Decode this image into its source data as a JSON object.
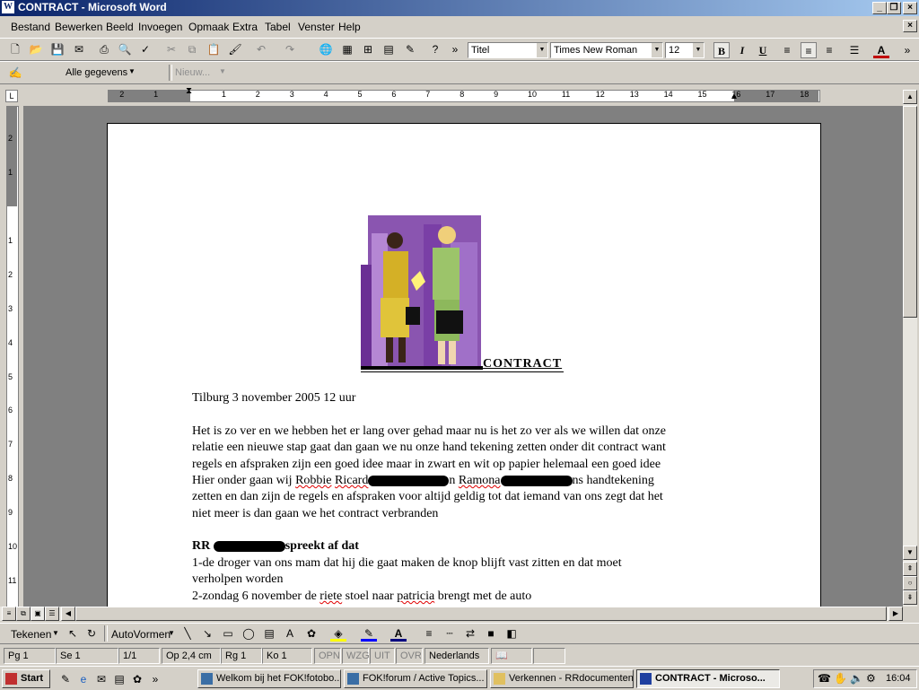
{
  "window": {
    "title": "CONTRACT - Microsoft Word"
  },
  "menu": [
    "Bestand",
    "Bewerken",
    "Beeld",
    "Invoegen",
    "Opmaak",
    "Extra",
    "Tabel",
    "Venster",
    "Help"
  ],
  "formatting": {
    "style": "Titel",
    "font": "Times New Roman",
    "size": "12",
    "bold": "B",
    "italic": "I",
    "underline": "U"
  },
  "reviewing": {
    "show": "Alle gegevens",
    "new_comment": "Nieuw..."
  },
  "ruler": {
    "labels": [
      "2",
      "1",
      "1",
      "2",
      "3",
      "4",
      "5",
      "6",
      "7",
      "8",
      "9",
      "10",
      "11",
      "12",
      "13",
      "14",
      "15",
      "16",
      "17",
      "18"
    ]
  },
  "vruler": {
    "labels": [
      "2",
      "1",
      "1",
      "2",
      "3",
      "4",
      "5",
      "6",
      "7",
      "8",
      "9",
      "10",
      "11"
    ]
  },
  "document": {
    "heading": "CONTRACT",
    "date_line": "Tilburg 3 november 2005 12 uur",
    "para": [
      "Het is zo ver en we hebben het er lang over gehad maar nu is het zo ver als we willen dat onze",
      "relatie een nieuwe stap gaat dan gaan we nu onze hand tekening zetten onder dit contract want",
      "regels en afspraken zijn een goed idee maar in zwart en wit op papier helemaal een goed idee"
    ],
    "line4": {
      "a": "Hier onder gaan wij ",
      "name1": "Robbie",
      "b": " ",
      "name2": "Ricard",
      "c": "n ",
      "name3": "Ramona",
      "d": "ns handtekening"
    },
    "para2": [
      "zetten en dan zijn de regels en afspraken voor altijd geldig tot dat iemand van ons zegt dat het",
      "niet meer is dan gaan we het contract verbranden"
    ],
    "sub_heading": {
      "a": "RR",
      "b": "spreekt af dat"
    },
    "list": [
      "1-de droger van ons mam dat hij die gaat maken de knop blijft vast zitten en dat moet",
      "verholpen worden"
    ],
    "item2": {
      "a": "2-zondag 6 november de ",
      "riete": "riete",
      "b": " stoel naar ",
      "patricia": "patricia",
      "c": " brengt met de auto"
    }
  },
  "drawing": {
    "draw": "Tekenen",
    "autoshapes": "AutoVormen"
  },
  "status": {
    "page": "Pg 1",
    "section": "Se 1",
    "pages": "1/1",
    "at": "Op 2,4 cm",
    "line": "Rg 1",
    "col": "Ko 1",
    "rec": "OPN",
    "trk": "WZG",
    "ext": "UIT",
    "ovr": "OVR",
    "lang": "Nederlands"
  },
  "taskbar": {
    "start": "Start",
    "tasks": [
      "Welkom bij het FOK!fotobo...",
      "FOK!forum / Active Topics...",
      "Verkennen - RRdocumenten",
      "CONTRACT - Microso..."
    ],
    "clock": "16:04"
  }
}
